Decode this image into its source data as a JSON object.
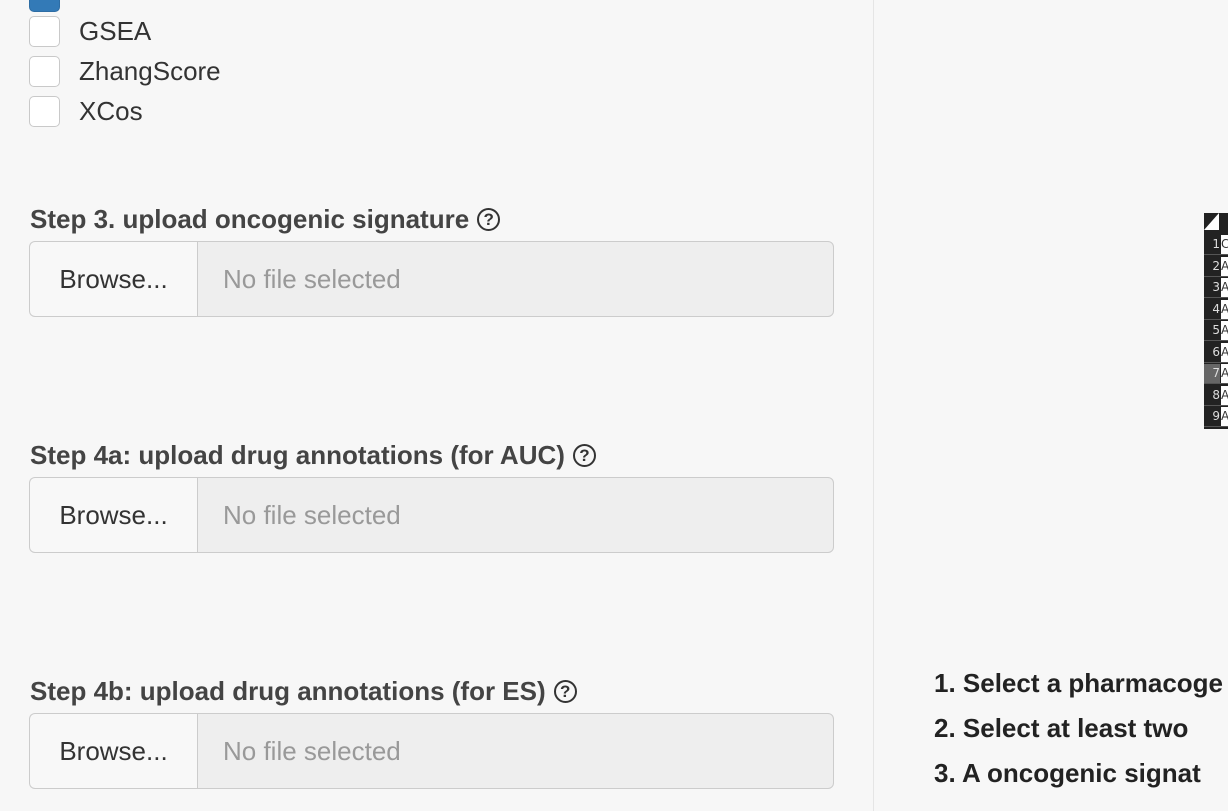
{
  "methods": [
    {
      "label": "GSEA",
      "checked": false
    },
    {
      "label": "ZhangScore",
      "checked": false
    },
    {
      "label": "XCos",
      "checked": false
    }
  ],
  "steps": {
    "step3": {
      "label": "Step 3. upload oncogenic signature",
      "browse": "Browse...",
      "placeholder": "No file selected"
    },
    "step4a": {
      "label": "Step 4a: upload drug annotations (for AUC)",
      "browse": "Browse...",
      "placeholder": "No file selected"
    },
    "step4b": {
      "label": "Step 4b: upload drug annotations (for ES)",
      "browse": "Browse...",
      "placeholder": "No file selected"
    }
  },
  "help_glyph": "?",
  "preview_table": {
    "rows": [
      {
        "num": "1",
        "cell": "C"
      },
      {
        "num": "2",
        "cell": "A"
      },
      {
        "num": "3",
        "cell": "A"
      },
      {
        "num": "4",
        "cell": "A"
      },
      {
        "num": "5",
        "cell": "A"
      },
      {
        "num": "6",
        "cell": "A"
      },
      {
        "num": "7",
        "cell": "A"
      },
      {
        "num": "8",
        "cell": "A"
      },
      {
        "num": "9",
        "cell": "A"
      }
    ]
  },
  "instructions": [
    "1. Select a pharmacoge",
    "2. Select at least two",
    "3. A oncogenic signat"
  ],
  "colors": {
    "accent": "#337ab7",
    "field_bg": "#eeeeee",
    "page_bg": "#f7f7f7"
  }
}
